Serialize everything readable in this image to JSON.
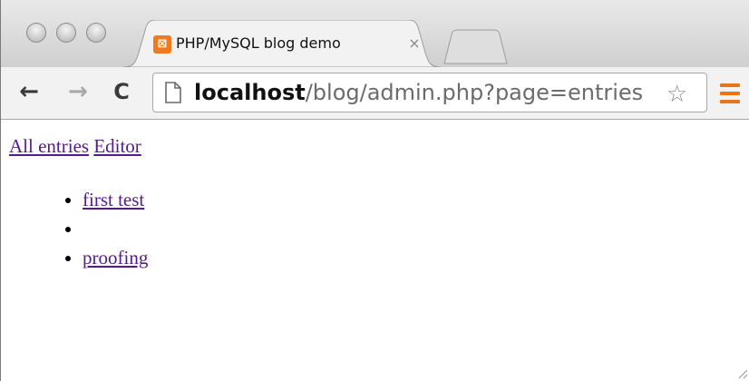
{
  "browser": {
    "tab": {
      "title": "PHP/MySQL blog demo",
      "close_glyph": "×",
      "favicon_glyph": "⊠"
    },
    "toolbar": {
      "back_glyph": "←",
      "forward_glyph": "→",
      "reload_glyph": "C",
      "url_host": "localhost",
      "url_path": "/blog/admin.php?page=entries",
      "star_glyph": "☆"
    }
  },
  "page": {
    "nav": {
      "all_entries": "All entries",
      "editor": "Editor"
    },
    "entries": [
      {
        "title": "first test"
      },
      {
        "title": ""
      },
      {
        "title": "proofing"
      }
    ]
  },
  "icons": [
    "close-icon",
    "favicon",
    "back-arrow-icon",
    "forward-arrow-icon",
    "reload-icon",
    "page-icon",
    "star-icon",
    "menu-icon"
  ],
  "colors": {
    "link": "#551a8b",
    "menu_accent": "#e8751a",
    "favicon": "#f07a23"
  }
}
